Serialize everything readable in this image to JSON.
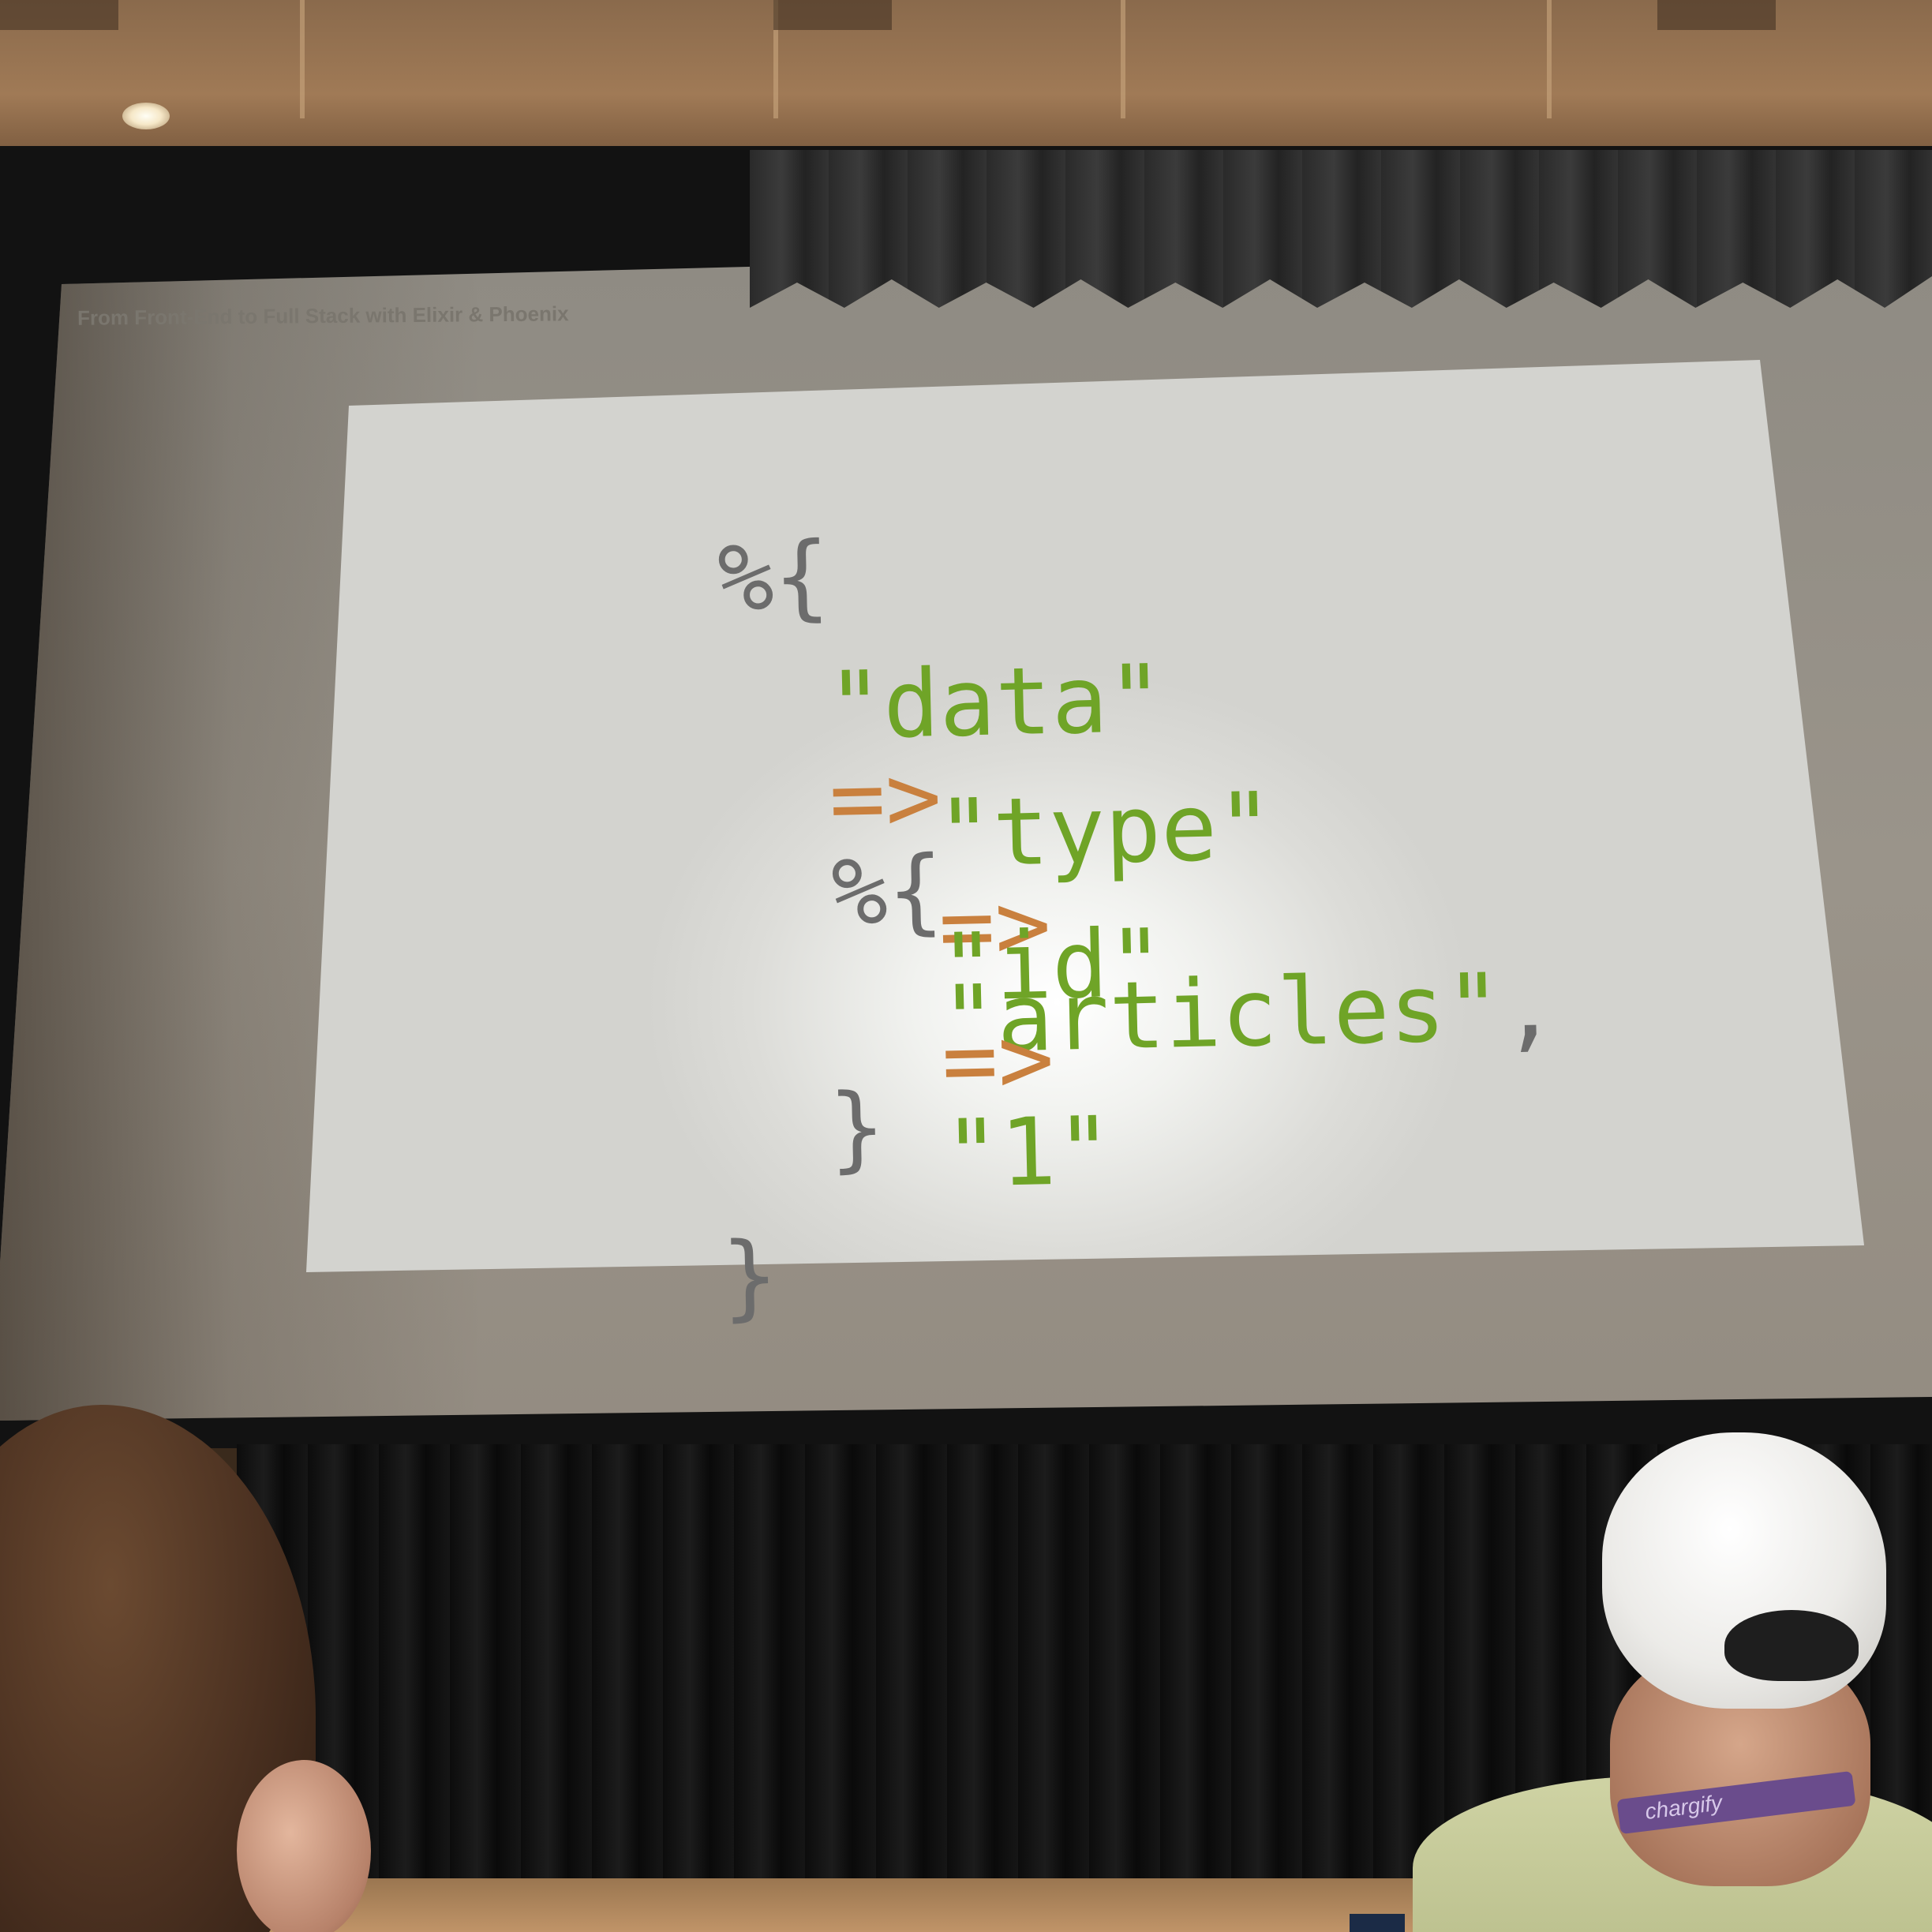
{
  "slide": {
    "header": "From Front-End to Full Stack with Elixir & Phoenix",
    "code_lines": [
      {
        "parts": [
          "%{"
        ]
      },
      {
        "parts": [
          "\"data\"",
          "=>",
          "%{"
        ]
      },
      {
        "parts": [
          "\"type\"",
          "=>",
          "\"articles\"",
          ","
        ]
      },
      {
        "parts": [
          "\"id\"",
          "=>",
          "\"1\""
        ]
      },
      {
        "parts": [
          "}"
        ]
      },
      {
        "parts": [
          "}"
        ]
      }
    ]
  },
  "audience": {
    "lanyard_text": "chargify"
  },
  "colors": {
    "string": "#6fa427",
    "operator": "#c9803e",
    "symbol": "#6c6c6c"
  }
}
